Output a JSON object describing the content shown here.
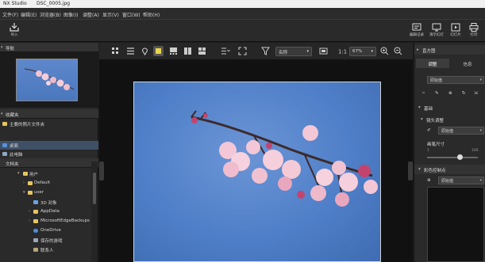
{
  "window": {
    "app_name": "NX Studio",
    "file_name": "DSC_0005.jpg"
  },
  "menu": [
    {
      "label": "文件(F)"
    },
    {
      "label": "编辑(E)"
    },
    {
      "label": "浏览器(B)"
    },
    {
      "label": "图像(I)"
    },
    {
      "label": "调整(A)"
    },
    {
      "label": "显示(V)"
    },
    {
      "label": "窗口(W)"
    },
    {
      "label": "帮助(H)"
    }
  ],
  "toolbar": {
    "import_label": "导入",
    "right_buttons": [
      {
        "label": "编辑记录",
        "icon": "edit-history-icon"
      },
      {
        "label": "演示幻灯",
        "icon": "slideshow-icon"
      },
      {
        "label": "幻灯片",
        "icon": "play-icon"
      },
      {
        "label": "打印",
        "icon": "print-icon"
      }
    ]
  },
  "left_panel": {
    "navigator_title": "导航",
    "favorites_title": "收藏夹",
    "favorites_items": [
      {
        "label": "主要的照片文件夹"
      }
    ],
    "desktop_label": "桌面",
    "this_pc_label": "此电脑",
    "docs_title": "文档夹",
    "tree": [
      {
        "label": "用户",
        "depth": 0
      },
      {
        "label": "Default",
        "depth": 1
      },
      {
        "label": "user",
        "depth": 1
      },
      {
        "label": "3D 对象",
        "depth": 2
      },
      {
        "label": "AppData",
        "depth": 2
      },
      {
        "label": "MicrosoftEdgeBackups",
        "depth": 2
      },
      {
        "label": "OneDrive",
        "depth": 2
      },
      {
        "label": "保存的游戏",
        "depth": 2
      },
      {
        "label": "联系人",
        "depth": 2
      }
    ]
  },
  "center": {
    "sort_label": "名称",
    "zoom_label": "67%"
  },
  "right_panel": {
    "title": "直方图",
    "tabs": [
      {
        "label": "调整"
      },
      {
        "label": "信息"
      }
    ],
    "preset_value": "原始值",
    "basic_title": "基础",
    "lens_title": "镜头调整",
    "lens_value": "原始值",
    "lens_size_label": "画笔尺寸",
    "slider_min": "1",
    "slider_max": "100",
    "control_point_title": "彩色控制点",
    "control_point_value": "原始值"
  },
  "colors": {
    "accent": "#3f4f66",
    "sky": "#4f7fc8",
    "panel": "#2a2a2a"
  }
}
